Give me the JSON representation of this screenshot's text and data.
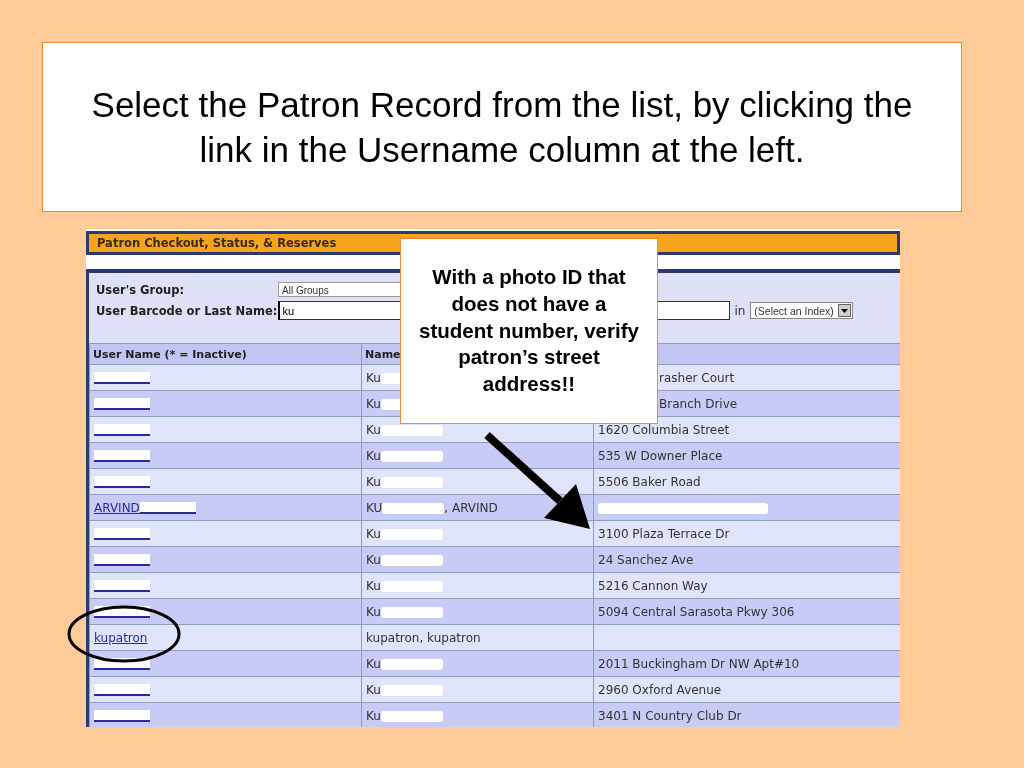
{
  "slide": {
    "title": "Select the Patron Record from the list, by clicking the link in the Username column at the left."
  },
  "app": {
    "header": "Patron Checkout, Status, & Reserves",
    "form": {
      "group_label": "User's Group:",
      "group_value": "All Groups",
      "search_label": "User Barcode or Last Name:",
      "search_value": "ku",
      "index_label": "in",
      "index_value": "(Select an Index)"
    },
    "table": {
      "columns": [
        "User Name (* = Inactive)",
        "Name"
      ],
      "rows": [
        {
          "username_redacted": true,
          "name": "Ku",
          "name_redacted": true,
          "address": "rasher Court",
          "address_covered": true
        },
        {
          "username_redacted": true,
          "name": "Ku",
          "name_redacted": true,
          "address": "Branch Drive",
          "address_covered": true
        },
        {
          "username_redacted": true,
          "name": "Ku",
          "name_redacted": true,
          "address": "1620 Columbia Street",
          "address_covered": false
        },
        {
          "username_redacted": true,
          "name": "Ku",
          "name_redacted": true,
          "address": "535 W Downer Place",
          "address_covered": false
        },
        {
          "username_redacted": true,
          "name": "Ku",
          "name_redacted": true,
          "address": "5506 Baker Road",
          "address_covered": false
        },
        {
          "username": "ARVIND",
          "username_redacted": true,
          "name": "KU",
          "name_redacted": true,
          "name_suffix": ", ARVIND",
          "address_redacted": true,
          "address_covered": false
        },
        {
          "username_redacted": true,
          "name": "Ku",
          "name_redacted": true,
          "address": "3100 Plaza Terrace Dr",
          "address_covered": false
        },
        {
          "username_redacted": true,
          "name": "Ku",
          "name_redacted": true,
          "address": "24 Sanchez Ave",
          "address_covered": false
        },
        {
          "username_redacted": true,
          "name": "Ku",
          "name_redacted": true,
          "address": "5216 Cannon Way",
          "address_covered": false
        },
        {
          "username_redacted": true,
          "name": "Ku",
          "name_redacted": true,
          "address": "5094 Central Sarasota Pkwy 306",
          "address_covered": false
        },
        {
          "username": "kupatron",
          "username_redacted": false,
          "name": "kupatron, kupatron",
          "name_redacted": false,
          "address_covered": false
        },
        {
          "username_redacted": true,
          "name": "Ku",
          "name_redacted": true,
          "address": "2011 Buckingham Dr NW Apt#10",
          "address_covered": false
        },
        {
          "username_redacted": true,
          "name": "Ku",
          "name_redacted": true,
          "address": "2960 Oxford Avenue",
          "address_covered": false
        },
        {
          "username_redacted": true,
          "name": "Ku",
          "name_redacted": true,
          "address": "3401 N Country Club Dr",
          "address_covered": false
        }
      ]
    }
  },
  "callout": {
    "text": "With a photo ID that does not have a student number, verify patron’s street address!!"
  }
}
